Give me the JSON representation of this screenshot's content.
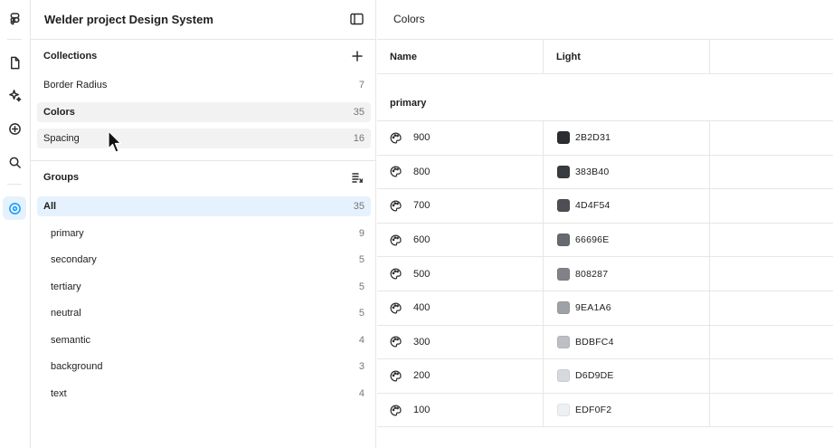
{
  "left_panel": {
    "title": "Welder project Design System",
    "collections_title": "Collections",
    "collections": [
      {
        "label": "Border Radius",
        "count": "7"
      },
      {
        "label": "Colors",
        "count": "35"
      },
      {
        "label": "Spacing",
        "count": "16"
      }
    ],
    "groups_title": "Groups",
    "groups": [
      {
        "label": "All",
        "count": "35"
      },
      {
        "label": "primary",
        "count": "9"
      },
      {
        "label": "secondary",
        "count": "5"
      },
      {
        "label": "tertiary",
        "count": "5"
      },
      {
        "label": "neutral",
        "count": "5"
      },
      {
        "label": "semantic",
        "count": "4"
      },
      {
        "label": "background",
        "count": "3"
      },
      {
        "label": "text",
        "count": "4"
      }
    ]
  },
  "main": {
    "title": "Colors",
    "columns": {
      "name": "Name",
      "light": "Light"
    },
    "group_label": "primary",
    "rows": [
      {
        "name": "900",
        "value": "2B2D31",
        "color": "#2B2D31"
      },
      {
        "name": "800",
        "value": "383B40",
        "color": "#383B40"
      },
      {
        "name": "700",
        "value": "4D4F54",
        "color": "#4D4F54"
      },
      {
        "name": "600",
        "value": "66696E",
        "color": "#66696E"
      },
      {
        "name": "500",
        "value": "808287",
        "color": "#808287"
      },
      {
        "name": "400",
        "value": "9EA1A6",
        "color": "#9EA1A6"
      },
      {
        "name": "300",
        "value": "BDBFC4",
        "color": "#BDBFC4"
      },
      {
        "name": "200",
        "value": "D6D9DE",
        "color": "#D6D9DE"
      },
      {
        "name": "100",
        "value": "EDF0F2",
        "color": "#EDF0F2"
      }
    ]
  },
  "icons": {
    "rail": [
      "figma-logo-icon",
      "file-icon",
      "sparkle-icon",
      "plus-circle-icon",
      "search-icon",
      "variables-icon"
    ],
    "row": "palette-icon"
  },
  "colors": {
    "accent": "#0d99ff",
    "selected_bg": "#e5f2fd",
    "hover_bg": "#f2f2f2",
    "border": "#e6e6e6"
  }
}
